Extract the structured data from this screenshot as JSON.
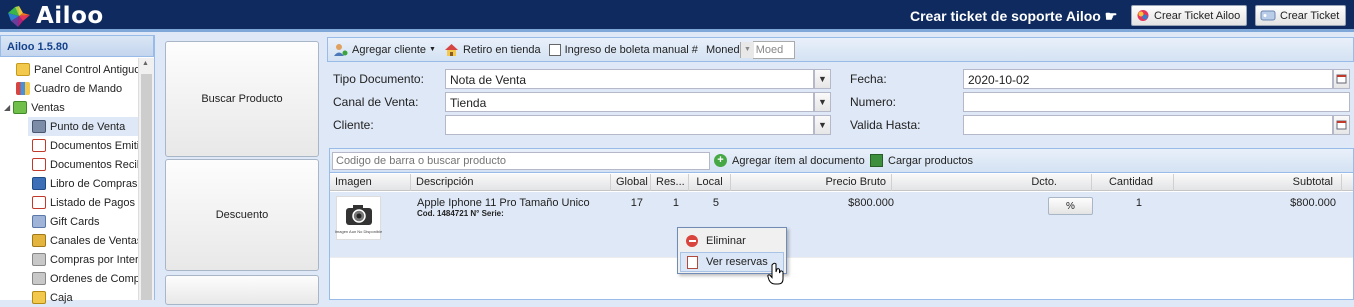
{
  "colors": {
    "topbar": "#0e2a5e",
    "panel": "#dfe8f6",
    "accent": "#99bbe8"
  },
  "header": {
    "logo_text": "Ailoo",
    "support_title": "Crear ticket de soporte Ailoo ☛",
    "ticket_ailoo_btn": "Crear Ticket Ailoo",
    "ticket_btn": "Crear Ticket"
  },
  "sidebar": {
    "title": "Ailoo 1.5.80",
    "items": [
      {
        "label": "Panel Control Antiguo",
        "icon": "folder-icon"
      },
      {
        "label": "Cuadro de Mando",
        "icon": "chart-icon"
      },
      {
        "label": "Ventas",
        "icon": "money-icon"
      },
      {
        "label": "Punto de Venta",
        "icon": "pos-icon"
      },
      {
        "label": "Documentos Emitidos",
        "icon": "document-icon"
      },
      {
        "label": "Documentos Recibidos",
        "icon": "document-icon"
      },
      {
        "label": "Libro de Compras y Ventas",
        "icon": "book-icon"
      },
      {
        "label": "Listado de Pagos",
        "icon": "document-icon"
      },
      {
        "label": "Gift Cards",
        "icon": "giftcard-icon"
      },
      {
        "label": "Canales de Ventas",
        "icon": "cart-icon"
      },
      {
        "label": "Compras por Internet",
        "icon": "cart-icon"
      },
      {
        "label": "Ordenes de Compra",
        "icon": "cart-icon"
      },
      {
        "label": "Caja",
        "icon": "cash-icon"
      }
    ]
  },
  "actions": {
    "buscar_producto": "Buscar Producto",
    "descuento": "Descuento"
  },
  "toolbar": {
    "agregar_cliente": "Agregar cliente",
    "retiro_tienda": "Retiro en tienda",
    "ingreso_boleta": "Ingreso de boleta manual #",
    "moneda_label": "Moneda:",
    "moneda_value": "Moed"
  },
  "form": {
    "tipo_documento_label": "Tipo Documento:",
    "tipo_documento_value": "Nota de Venta",
    "canal_venta_label": "Canal de Venta:",
    "canal_venta_value": "Tienda",
    "cliente_label": "Cliente:",
    "cliente_value": "",
    "fecha_label": "Fecha:",
    "fecha_value": "2020-10-02",
    "numero_label": "Numero:",
    "numero_value": "",
    "valida_hasta_label": "Valida Hasta:",
    "valida_hasta_value": ""
  },
  "grid_toolbar": {
    "search_placeholder": "Codigo de barra o buscar producto",
    "agregar_item": "Agregar ítem al documento",
    "cargar_productos": "Cargar productos"
  },
  "grid": {
    "columns": [
      "Imagen",
      "Descripción",
      "Global",
      "Res...",
      "Local",
      "Precio Bruto",
      "Dcto.",
      "Cantidad",
      "Subtotal"
    ],
    "rows": [
      {
        "image_caption": "Imagen Aun No Disponible",
        "description": "Apple Iphone 11 Pro Tamaño Unico",
        "code_line": "Cod. 1484721 N° Serie:",
        "global": "17",
        "reservado": "1",
        "local": "5",
        "precio_bruto": "$800.000",
        "dcto_btn": "%",
        "cantidad": "1",
        "subtotal": "$800.000"
      }
    ]
  },
  "context_menu": {
    "eliminar": "Eliminar",
    "ver_reservas": "Ver reservas"
  }
}
